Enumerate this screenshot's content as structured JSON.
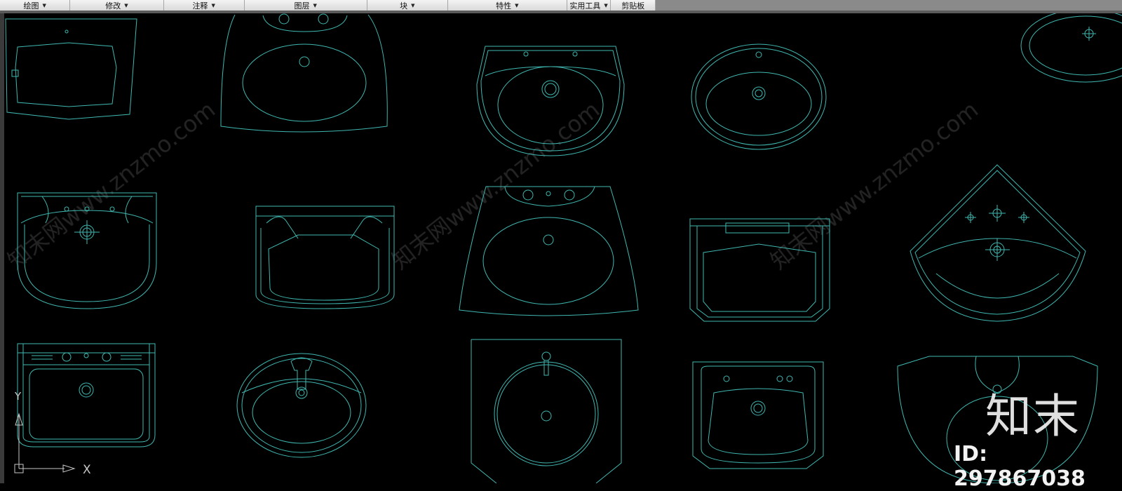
{
  "ribbon": {
    "panels": [
      {
        "label": "绘图",
        "dropdown": true
      },
      {
        "label": "修改",
        "dropdown": true
      },
      {
        "label": "注释",
        "dropdown": true
      },
      {
        "label": "图层",
        "dropdown": true
      },
      {
        "label": "块",
        "dropdown": true
      },
      {
        "label": "特性",
        "dropdown": true
      },
      {
        "label": "实用工具",
        "dropdown": true
      },
      {
        "label": "剪贴板",
        "dropdown": false
      }
    ]
  },
  "ucs": {
    "x_label": "X",
    "y_label": "Y"
  },
  "watermark": {
    "site": "知末网www.znzmo.com",
    "logo": "知末",
    "id_text": "ID: 297867038"
  },
  "colors": {
    "background": "#000000",
    "line": "#3fb7b0",
    "ucs": "#c8c8c8"
  }
}
